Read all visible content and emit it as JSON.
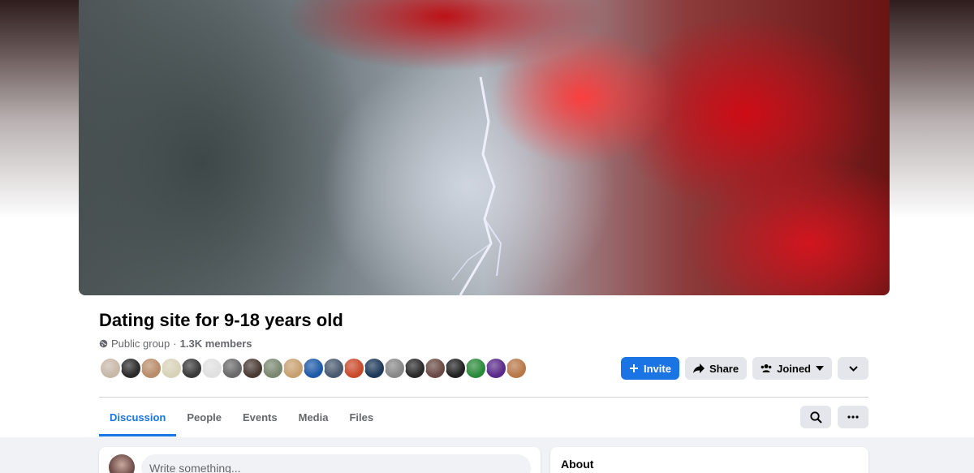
{
  "group": {
    "name": "Dating site for 9-18 years old",
    "privacy": "Public group",
    "separator": "·",
    "members": "1.3K members",
    "member_avatar_colors": [
      "#c8b8a8",
      "#2a2a2a",
      "#b98c6a",
      "#d8d2b8",
      "#3a3a3a",
      "#e0e0e0",
      "#6a6a6a",
      "#4a3a34",
      "#7a8870",
      "#c8a070",
      "#1e5aa8",
      "#4a5a70",
      "#c84a2a",
      "#1e3a5a",
      "#888888",
      "#2a2a2a",
      "#6a4a44",
      "#222222",
      "#2a8a3a",
      "#5a2a8a",
      "#b87848"
    ]
  },
  "actions": {
    "invite_label": "Invite",
    "share_label": "Share",
    "joined_label": "Joined"
  },
  "tabs": [
    {
      "label": "Discussion",
      "active": true
    },
    {
      "label": "People"
    },
    {
      "label": "Events"
    },
    {
      "label": "Media"
    },
    {
      "label": "Files"
    }
  ],
  "composer": {
    "placeholder": "Write something..."
  },
  "about": {
    "title": "About"
  },
  "colors": {
    "accent": "#1b74e4",
    "muted_text": "#65676b",
    "button_gray": "#e4e6eb",
    "feed_bg": "#f0f2f5"
  },
  "icons": {
    "privacy": "globe-icon",
    "invite": "plus-icon",
    "share": "share-arrow-icon",
    "joined": "people-icon",
    "dropdown": "chevron-down-icon",
    "search": "search-icon",
    "more": "more-horizontal-icon"
  }
}
